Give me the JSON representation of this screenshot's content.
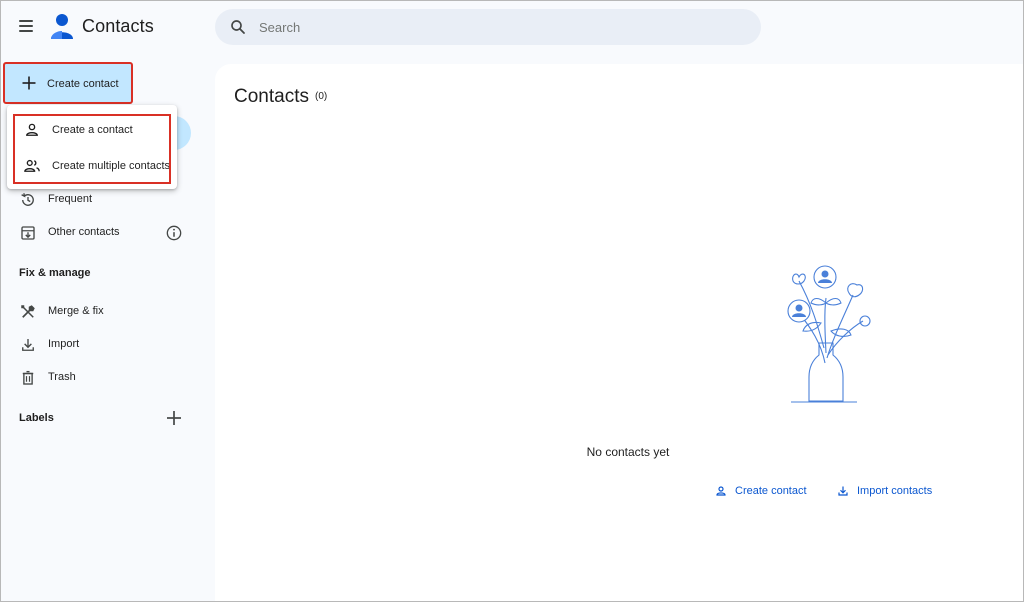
{
  "header": {
    "app_title": "Contacts",
    "menu_icon": "hamburger-menu-icon",
    "logo_icon": "contacts-person-logo-icon",
    "search": {
      "placeholder": "Search",
      "value": "",
      "icon": "search-icon"
    }
  },
  "sidebar": {
    "create_button": {
      "label": "Create contact",
      "icon": "plus-icon"
    },
    "items": [
      {
        "label": "Frequent",
        "icon": "history-icon"
      },
      {
        "label": "Other contacts",
        "icon": "archive-download-icon",
        "info_icon": "info-icon"
      }
    ],
    "fix_manage": {
      "title": "Fix & manage",
      "items": [
        {
          "label": "Merge & fix",
          "icon": "tools-icon"
        },
        {
          "label": "Import",
          "icon": "download-icon"
        },
        {
          "label": "Trash",
          "icon": "trash-icon"
        }
      ]
    },
    "labels": {
      "title": "Labels",
      "add_icon": "plus-icon"
    }
  },
  "dropdown": {
    "items": [
      {
        "label": "Create a contact",
        "icon": "person-icon"
      },
      {
        "label": "Create multiple contacts",
        "icon": "people-icon"
      }
    ]
  },
  "main": {
    "title": "Contacts",
    "count": "(0)",
    "empty_state": {
      "illustration": "flowers-vase-contacts-illustration",
      "message": "No contacts yet",
      "links": [
        {
          "label": "Create contact",
          "icon": "person-icon"
        },
        {
          "label": "Import contacts",
          "icon": "download-icon"
        }
      ]
    }
  },
  "colors": {
    "accent": "#0b57d0",
    "selected_bg": "#c2e7ff",
    "highlight_border": "#d93025",
    "search_bg": "#e9eef6",
    "sidebar_bg": "#f8fafd"
  }
}
